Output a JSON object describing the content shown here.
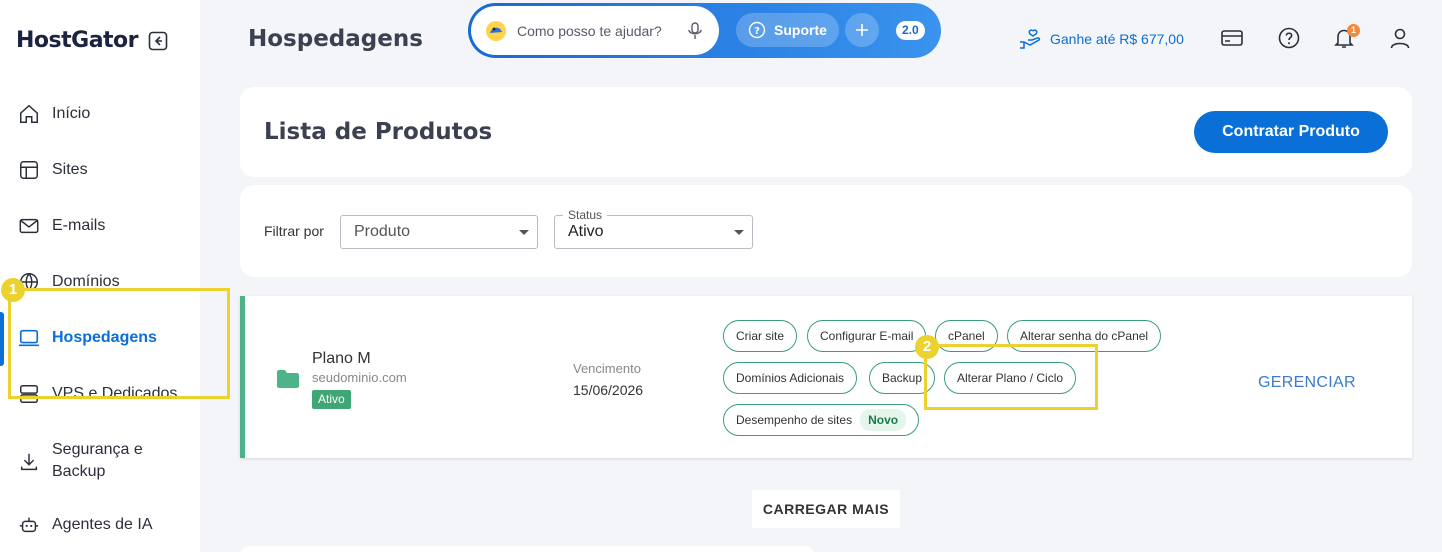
{
  "brand": {
    "logo": "HostGator"
  },
  "sidebar": {
    "items": [
      {
        "label": "Início",
        "icon": "home-icon"
      },
      {
        "label": "Sites",
        "icon": "layout-icon"
      },
      {
        "label": "E-mails",
        "icon": "mail-icon"
      },
      {
        "label": "Domínios",
        "icon": "globe-icon"
      },
      {
        "label": "Hospedagens",
        "icon": "laptop-icon",
        "active": true
      },
      {
        "label": "VPS e Dedicados",
        "icon": "server-icon"
      },
      {
        "label": "Segurança e Backup",
        "label_line1": "Segurança e",
        "label_line2": "Backup",
        "icon": "download-icon"
      },
      {
        "label": "Agentes de IA",
        "icon": "robot-icon"
      }
    ]
  },
  "header": {
    "title": "Hospedagens",
    "assistant": {
      "placeholder": "Como posso te ajudar?",
      "support_label": "Suporte",
      "version": "2.0"
    },
    "earn_label": "Ganhe até R$ 677,00",
    "notification_count": "1"
  },
  "products_card": {
    "title": "Lista de Produtos",
    "cta_label": "Contratar Produto"
  },
  "filters": {
    "label": "Filtrar por",
    "product_select": {
      "value": "Produto"
    },
    "status_select": {
      "legend": "Status",
      "value": "Ativo"
    }
  },
  "product": {
    "name": "Plano M",
    "domain": "seudominio.com",
    "status": "Ativo",
    "due_label": "Vencimento",
    "due_date": "15/06/2026",
    "actions": [
      "Criar site",
      "Configurar E-mail",
      "cPanel",
      "Alterar senha do cPanel",
      "Domínios Adicionais",
      "Backup",
      "Alterar Plano / Ciclo",
      "Desempenho de sites"
    ],
    "new_tag": "Novo",
    "manage_label": "GERENCIAR"
  },
  "load_more_label": "CARREGAR MAIS",
  "tutorial": {
    "step1": "1",
    "step2": "2"
  },
  "colors": {
    "primary": "#0a6fd6",
    "accent_green": "#3ea775",
    "highlight": "#ecd22e"
  }
}
